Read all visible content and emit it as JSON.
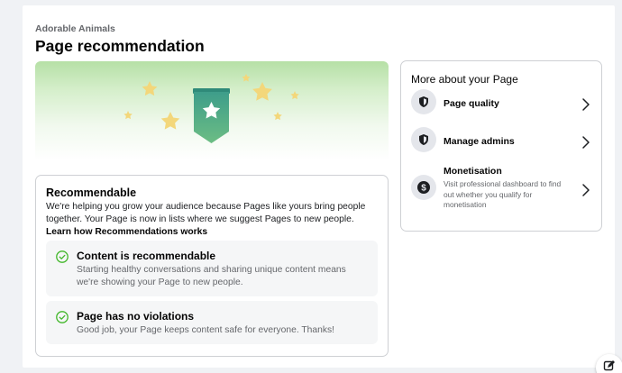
{
  "header": {
    "page_name": "Adorable Animals",
    "title": "Page recommendation"
  },
  "hero": {
    "badge_icon": "star-badge-icon",
    "colors": {
      "badge": "#4fa88a",
      "stars": "#f3d77b",
      "gradient_top": "#b6e0a6"
    }
  },
  "recommendable": {
    "title": "Recommendable",
    "description": "We're helping you grow your audience because Pages like yours bring people together. Your Page is now in lists where we suggest Pages to new people.",
    "link": "Learn how Recommendations works",
    "items": [
      {
        "title": "Content is recommendable",
        "description": "Starting healthy conversations and sharing unique content means we're showing your Page to new people.",
        "icon": "check-circle-icon"
      },
      {
        "title": "Page has no violations",
        "description": "Good job, your Page keeps content safe for everyone. Thanks!",
        "icon": "check-circle-icon"
      }
    ]
  },
  "sidebar": {
    "title": "More about your Page",
    "items": [
      {
        "label": "Page quality",
        "icon": "shield-icon"
      },
      {
        "label": "Manage admins",
        "icon": "shield-icon"
      },
      {
        "label": "Monetisation",
        "subtitle": "Visit professional dashboard to find out whether you qualify for monetisation",
        "icon": "dollar-icon"
      }
    ]
  },
  "colors": {
    "check": "#42b72a",
    "text": "#050505",
    "secondary": "#65676b",
    "border": "#ced0d4"
  }
}
